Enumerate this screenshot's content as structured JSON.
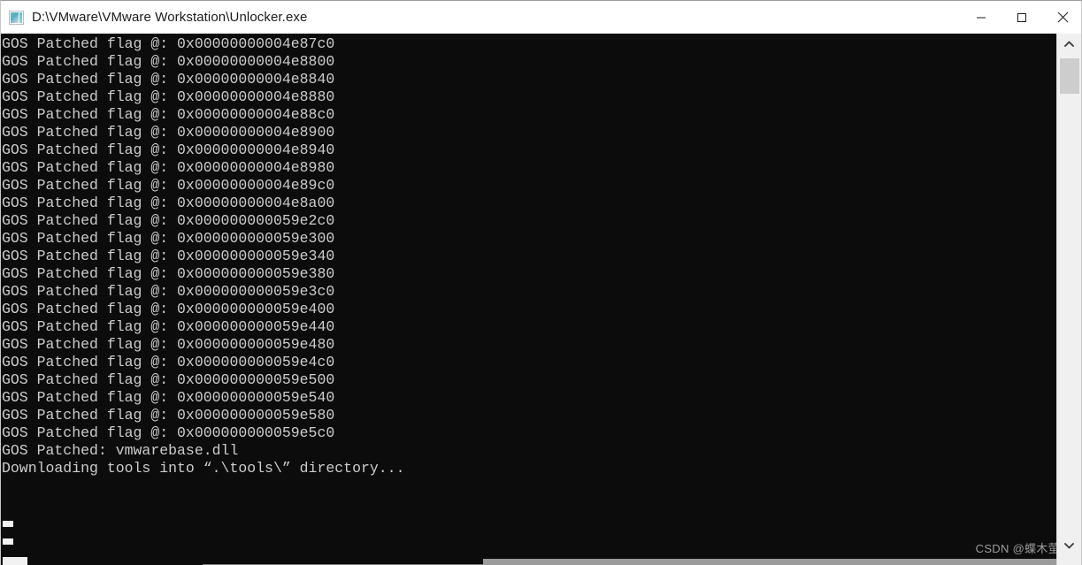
{
  "window": {
    "title": "D:\\VMware\\VMware Workstation\\Unlocker.exe",
    "app_icon": "console-window-icon",
    "background_color": "#0c0c0c",
    "titlebar_color": "#ffffff",
    "text_color": "#cccccc"
  },
  "window_controls": {
    "minimize_label": "Minimize",
    "maximize_label": "Maximize",
    "close_label": "Close"
  },
  "console": {
    "lines": [
      "GOS Patched flag @: 0x00000000004e87c0",
      "GOS Patched flag @: 0x00000000004e8800",
      "GOS Patched flag @: 0x00000000004e8840",
      "GOS Patched flag @: 0x00000000004e8880",
      "GOS Patched flag @: 0x00000000004e88c0",
      "GOS Patched flag @: 0x00000000004e8900",
      "GOS Patched flag @: 0x00000000004e8940",
      "GOS Patched flag @: 0x00000000004e8980",
      "GOS Patched flag @: 0x00000000004e89c0",
      "GOS Patched flag @: 0x00000000004e8a00",
      "GOS Patched flag @: 0x000000000059e2c0",
      "GOS Patched flag @: 0x000000000059e300",
      "GOS Patched flag @: 0x000000000059e340",
      "GOS Patched flag @: 0x000000000059e380",
      "GOS Patched flag @: 0x000000000059e3c0",
      "GOS Patched flag @: 0x000000000059e400",
      "GOS Patched flag @: 0x000000000059e440",
      "GOS Patched flag @: 0x000000000059e480",
      "GOS Patched flag @: 0x000000000059e4c0",
      "GOS Patched flag @: 0x000000000059e500",
      "GOS Patched flag @: 0x000000000059e540",
      "GOS Patched flag @: 0x000000000059e580",
      "GOS Patched flag @: 0x000000000059e5c0",
      "GOS Patched: vmwarebase.dll",
      "Downloading tools into “.\\tools\\” directory..."
    ]
  },
  "watermark": {
    "text": "CSDN @蝶木萤"
  },
  "scrollbars": {
    "vertical_up_arrow": "chevron-up-icon",
    "vertical_down_arrow": "chevron-down-icon"
  }
}
